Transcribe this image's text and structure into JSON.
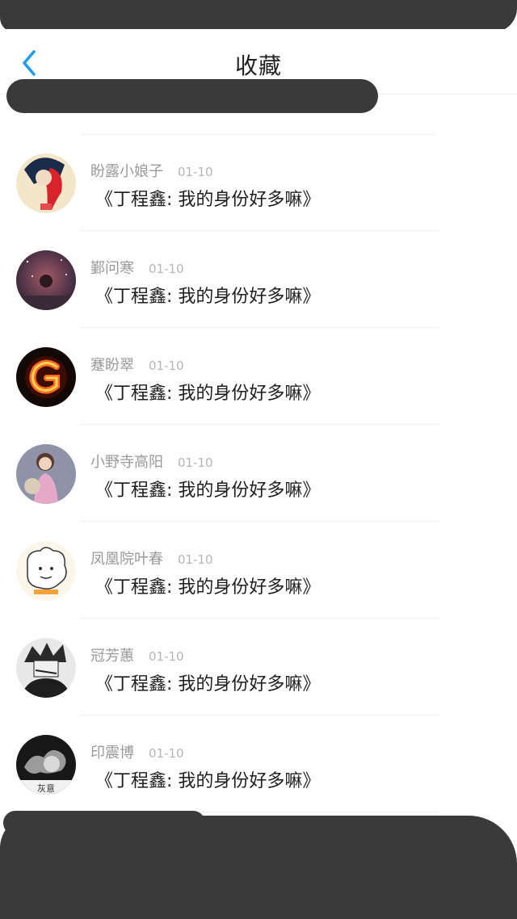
{
  "header": {
    "title": "收藏",
    "back_icon": "chevron-left-icon",
    "accent_color": "#1c9bf0"
  },
  "favorites": [
    {
      "name": "盼露小娘子",
      "date": "01-10",
      "message": "《丁程鑫: 我的身份好多嘛》",
      "avatar": "avatar-red-hair-girl"
    },
    {
      "name": "鄞问寒",
      "date": "01-10",
      "message": "《丁程鑫: 我的身份好多嘛》",
      "avatar": "avatar-night-sky"
    },
    {
      "name": "蹇盼翠",
      "date": "01-10",
      "message": "《丁程鑫: 我的身份好多嘛》",
      "avatar": "avatar-fire-letter-g"
    },
    {
      "name": "小野寺高阳",
      "date": "01-10",
      "message": "《丁程鑫: 我的身份好多嘛》",
      "avatar": "avatar-pink-dress-girl"
    },
    {
      "name": "凤凰院叶春",
      "date": "01-10",
      "message": "《丁程鑫: 我的身份好多嘛》",
      "avatar": "avatar-cartoon-sketch"
    },
    {
      "name": "冠芳蕙",
      "date": "01-10",
      "message": "《丁程鑫: 我的身份好多嘛》",
      "avatar": "avatar-anime-boy"
    },
    {
      "name": "印震博",
      "date": "01-10",
      "message": "《丁程鑫: 我的身份好多嘛》",
      "avatar": "avatar-bw-smoke",
      "avatar_caption": "灰意"
    }
  ]
}
